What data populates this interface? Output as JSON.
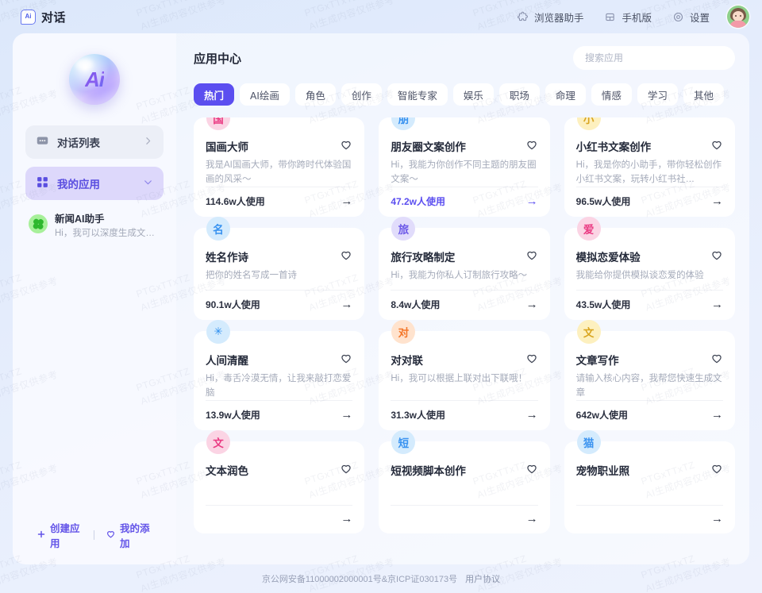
{
  "header": {
    "brand_badge": "Ai",
    "brand_title": "对话",
    "nav": [
      {
        "label": "浏览器助手",
        "icon": "puzzle-icon"
      },
      {
        "label": "手机版",
        "icon": "mobile-icon"
      },
      {
        "label": "设置",
        "icon": "gear-icon"
      }
    ],
    "avatar_name": "user-avatar"
  },
  "sidebar": {
    "logo_text": "Ai",
    "nav": [
      {
        "label": "对话列表",
        "icon": "chat-icon",
        "chevron": "›",
        "active": false
      },
      {
        "label": "我的应用",
        "icon": "grid-icon",
        "chevron": "⌄",
        "active": true
      }
    ],
    "apps": [
      {
        "title": "新闻AI助手",
        "desc": "Hi，我可以深度生成文案，也可…"
      }
    ],
    "footer": {
      "create_label": "创建应用",
      "create_icon": "plus-icon",
      "favorites_label": "我的添加",
      "favorites_icon": "heart-icon"
    }
  },
  "main": {
    "title": "应用中心",
    "search_placeholder": "搜索应用",
    "search_value": "",
    "tabs": [
      {
        "label": "热门",
        "active": true
      },
      {
        "label": "AI绘画",
        "active": false
      },
      {
        "label": "角色",
        "active": false
      },
      {
        "label": "创作",
        "active": false
      },
      {
        "label": "智能专家",
        "active": false
      },
      {
        "label": "娱乐",
        "active": false
      },
      {
        "label": "职场",
        "active": false
      },
      {
        "label": "命理",
        "active": false
      },
      {
        "label": "情感",
        "active": false
      },
      {
        "label": "学习",
        "active": false
      },
      {
        "label": "其他",
        "active": false
      }
    ],
    "cards": [
      {
        "badge": "国",
        "badge_bg": "#fbd4e4",
        "badge_fg": "#ea3a82",
        "title": "国画大师",
        "desc": "我是AI国画大师，带你跨时代体验国画的风采～",
        "usage": "114.6w人使用",
        "hovered": false
      },
      {
        "badge": "朋",
        "badge_bg": "#d4ebfd",
        "badge_fg": "#3a93f0",
        "title": "朋友圈文案创作",
        "desc": "Hi，我能为你创作不同主题的朋友圈文案～",
        "usage": "47.2w人使用",
        "hovered": true
      },
      {
        "badge": "小",
        "badge_bg": "#fdf0bf",
        "badge_fg": "#d9a520",
        "title": "小红书文案创作",
        "desc": "Hi，我是你的小助手，带你轻松创作小红书文案，玩转小红书社…",
        "usage": "96.5w人使用",
        "hovered": false
      },
      {
        "badge": "名",
        "badge_bg": "#d4ebfd",
        "badge_fg": "#3a93f0",
        "title": "姓名作诗",
        "desc": "把你的姓名写成一首诗",
        "usage": "90.1w人使用",
        "hovered": false
      },
      {
        "badge": "旅",
        "badge_bg": "#e1dcfb",
        "badge_fg": "#6d5ae8",
        "title": "旅行攻略制定",
        "desc": "Hi，我能为你私人订制旅行攻略～",
        "usage": "8.4w人使用",
        "hovered": false
      },
      {
        "badge": "爱",
        "badge_bg": "#fbd4e4",
        "badge_fg": "#ea3a82",
        "title": "模拟恋爱体验",
        "desc": "我能给你提供模拟谈恋爱的体验",
        "usage": "43.5w人使用",
        "hovered": false
      },
      {
        "badge": "✳",
        "badge_bg": "#d4ebfd",
        "badge_fg": "#2f90ef",
        "title": "人间清醒",
        "desc": "Hi，毒舌冷漠无情，让我来敲打恋爱脑",
        "usage": "13.9w人使用",
        "hovered": false
      },
      {
        "badge": "对",
        "badge_bg": "#ffe3ce",
        "badge_fg": "#f4772a",
        "title": "对对联",
        "desc": "Hi，我可以根据上联对出下联哦！",
        "usage": "31.3w人使用",
        "hovered": false
      },
      {
        "badge": "文",
        "badge_bg": "#fdf0bf",
        "badge_fg": "#d9a520",
        "title": "文章写作",
        "desc": "请输入核心内容，我帮您快速生成文章",
        "usage": "642w人使用",
        "hovered": false
      },
      {
        "badge": "文",
        "badge_bg": "#fbd4e4",
        "badge_fg": "#ea3a82",
        "title": "文本润色",
        "desc": "",
        "usage": "",
        "hovered": false
      },
      {
        "badge": "短",
        "badge_bg": "#d4ebfd",
        "badge_fg": "#3a93f0",
        "title": "短视频脚本创作",
        "desc": "",
        "usage": "",
        "hovered": false
      },
      {
        "badge": "猫",
        "badge_bg": "#d4ebfd",
        "badge_fg": "#3a93f0",
        "title": "宠物职业照",
        "desc": "",
        "usage": "",
        "hovered": false
      }
    ]
  },
  "footer": {
    "icp": "京公网安备11000002000001号&京ICP证030173号",
    "agreement": "用户协议"
  },
  "watermark": {
    "line1": "PTGxTTxTZ",
    "line2": "AI生成内容仅供参考"
  },
  "colors": {
    "accent": "#5b4ef0",
    "page_bg": "#e4ecfc"
  }
}
